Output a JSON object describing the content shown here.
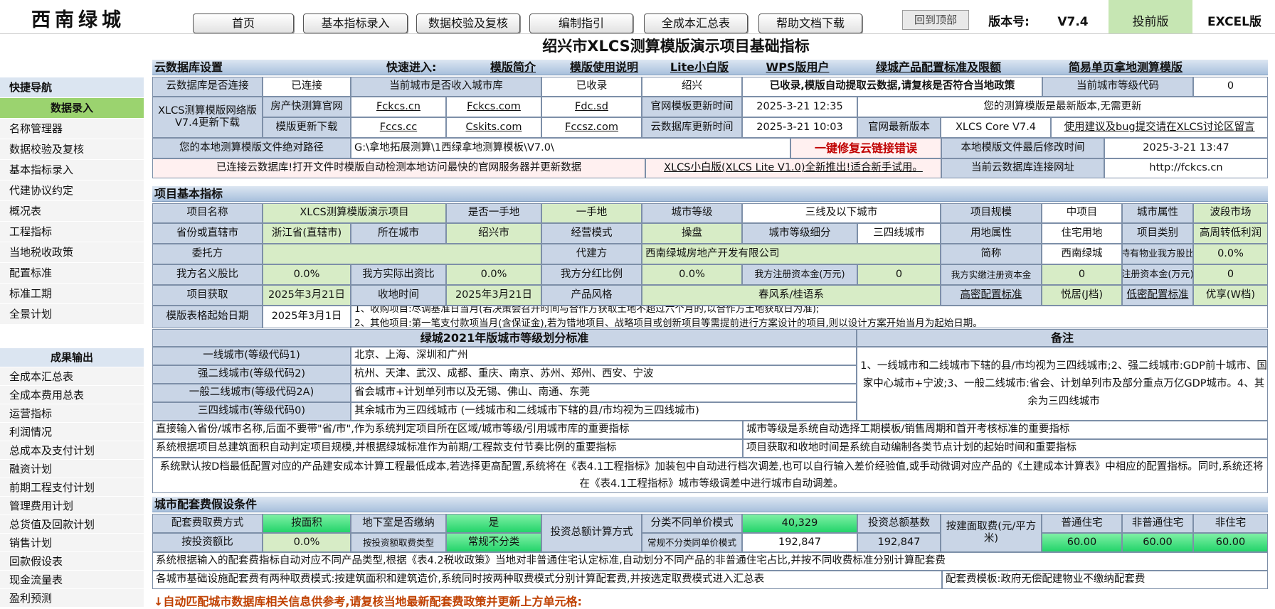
{
  "logo": "西南绿城",
  "nav": [
    "首页",
    "基本指标录入",
    "数据校验及复核",
    "编制指引",
    "全成本汇总表",
    "帮助文档下载"
  ],
  "back_top": "回到顶部",
  "version_label": "版本号:",
  "version_value": "V7.4",
  "edition": "投前版",
  "excel_edition": "EXCEL版",
  "page_title": "绍兴市XLCS测算模版演示项目基础指标",
  "sidebar": {
    "quick_title": "快捷导航",
    "quick": [
      "数据录入",
      "名称管理器",
      "数据校验及复核",
      "基本指标录入",
      "代建协议约定",
      "概况表",
      "工程指标",
      "当地税收政策",
      "配置标准",
      "标准工期",
      "全景计划"
    ],
    "output_title": "成果输出",
    "output": [
      "全成本汇总表",
      "全成本费用总表",
      "运营指标",
      "利润情况",
      "总成本及支付计划",
      "融资计划",
      "前期工程支付计划",
      "管理费用计划",
      "总货值及回款计划",
      "销售计划",
      "回款假设表",
      "现金流量表",
      "盈利预测"
    ]
  },
  "cloud": {
    "bar": "云数据库设置",
    "quick_label": "快速进入:",
    "links": [
      "模版简介",
      "模版使用说明",
      "Lite小白版",
      "WPS版用户",
      "绿城产品配置标准及限额",
      "简易单页拿地测算模版"
    ],
    "r1": [
      "云数据库是否连接",
      "已连接",
      "当前城市是否收入城市库",
      "已收录",
      "绍兴",
      "已收录,模版自动提取云数据,请复核是否符合当地政策",
      "当前城市等级代码",
      "0"
    ],
    "r23_label": "XLCS测算模版网络版V7.4更新下载",
    "r2": [
      "房产快测算官网",
      "Fckcs.cn",
      "Fckcs.com",
      "Fdc.sd",
      "官网模板更新时间",
      "2025-3-21  12:35",
      "您的测算模版是最新版本,无需更新"
    ],
    "r3": [
      "模版更新下载",
      "Fccs.cc",
      "Cskits.com",
      "Fccsz.com",
      "云数据库更新时间",
      "2025-3-21  10:03",
      "官网最新版本",
      "XLCS  Core V7.4",
      "使用建议及bug提交请在XLCS讨论区留言"
    ],
    "r4": [
      "您的本地测算模版文件绝对路径",
      "G:\\拿地拓展测算\\1西绿拿地测算模板\\V7.0\\",
      "一键修复云链接错误",
      "本地模版文件最后修改时间",
      "2025-3-21  13:47"
    ],
    "r5": [
      "已连接云数据库!打开文件时模版自动检测本地访问最快的官网服务器并更新数据",
      "XLCS小白版(XLCS Lite V1.0)全新推出!适合新手试用。",
      "当前云数据库连接网址",
      "http://fckcs.cn"
    ]
  },
  "project": {
    "bar": "项目基本指标",
    "r1": [
      "项目名称",
      "XLCS测算模版演示项目",
      "是否一手地",
      "一手地",
      "城市等级",
      "三线及以下城市",
      "项目规模",
      "中项目",
      "城市属性",
      "波段市场"
    ],
    "r2": [
      "省份或直辖市",
      "浙江省(直辖市)",
      "所在城市",
      "绍兴市",
      "经营模式",
      "操盘",
      "城市等级细分",
      "三四线城市",
      "用地属性",
      "住宅用地",
      "项目类别",
      "高周转低利润"
    ],
    "r3": [
      "委托方",
      "",
      "代建方",
      "西南绿城房地产开发有限公司",
      "简称",
      "西南绿城",
      "持有物业我方股比",
      "0.0%"
    ],
    "r4": [
      "我方名义股比",
      "0.0%",
      "我方实际出资比",
      "0.0%",
      "我方分红比例",
      "0.0%",
      "我方注册资本金(万元)",
      "0",
      "我方实缴注册资本金",
      "0",
      "注册资本金(万元)",
      "0"
    ],
    "r5": [
      "项目获取",
      "2025年3月21日",
      "收地时间",
      "2025年3月21日",
      "产品风格",
      "春风系/桂语系",
      "高密配置标准",
      "悦居(J档)",
      "低密配置标准",
      "优享(W档)"
    ],
    "r6": [
      "模版表格起始日期",
      "2025年3月1日",
      "1、收购项目:尽调基准日当月(若决策会召开时间与合作方获取土地不超过六个月的,以合作方土地获取日为准);",
      "2、其他项目:第一笔支付款项当月(含保证金),若为错地项目、战略项目或创新项目等需提前进行方案设计的项目,则以设计方案开始当月为起始日期。"
    ]
  },
  "citystd": {
    "title": "绿城2021年版城市等级划分标准",
    "note_title": "备注",
    "rows": [
      [
        "一线城市(等级代码1)",
        "北京、上海、深圳和广州"
      ],
      [
        "强二线城市(等级代码2)",
        "杭州、天津、武汉、成都、重庆、南京、苏州、郑州、西安、宁波"
      ],
      [
        "一般二线城市(等级代码2A)",
        "省会城市+计划单列市以及无锡、佛山、南通、东莞"
      ],
      [
        "三四线城市(等级代码0)",
        "其余城市为三四线城市 (一线城市和二线城市下辖的县/市均视为三四线城市)"
      ]
    ],
    "note": "1、一线城市和二线城市下辖的县/市均视为三四线城市;2、强二线城市:GDP前十城市、国家中心城市+宁波;3、一般二线城市:省会、计划单列市及部分重点万亿GDP城市。4、其余为三四线城市",
    "t1a": "直接输入省份/城市名称,后面不要带\"省/市\",作为系统判定项目所在区域/城市等级/引用城市库的重要指标",
    "t1b": "城市等级是系统自动选择工期模板/销售周期和首开考核标准的重要指标",
    "t2a": "系统根据项目总建筑面积自动判定项目规模,并根据绿城标准作为前期/工程款支付节奏比例的重要指标",
    "t2b": "项目获取和收地时间是系统自动编制各类节点计划的起始时间和重要指标",
    "t3": "系统默认按D档最低配置对应的产品建安成本计算工程最低成本,若选择更高配置,系统将在《表4.1工程指标》加装包中自动进行档次调差,也可以自行输入差价经验值,或手动微调对应产品的《土建成本计算表》中相应的配置指标。同时,系统还将在《表4.1工程指标》城市等级调差中进行城市自动调差。"
  },
  "fee": {
    "bar": "城市配套费假设条件",
    "r1": [
      "配套费取费方式",
      "按面积",
      "地下室是否缴纳",
      "是",
      "投资总额计算方式",
      "分类不同单价模式",
      "40,329",
      "投资总额基数",
      "192,847",
      "按建面取费(元/平方米)",
      "普通住宅",
      "非普通住宅",
      "非住宅"
    ],
    "r2": [
      "按投资额比",
      "0.0%",
      "按投资额取费类型",
      "常规不分类",
      "常规不分类同单价模式",
      "192,847",
      "60.00",
      "60.00",
      "60.00"
    ],
    "n1": "系统根据输入的配套费指标自动对应不同产品类型,根据《表4.2税收政策》当地对非普通住宅认定标准,自动划分不同产品的非普通住宅占比,并按不同收费标准分别计算配套费",
    "n2a": "各城市基础设施配套费有两种取费模式:按建筑面积和建筑造价,系统同时按两种取费模式分别计算配套费,并按选定取费模式进入汇总表",
    "n2b": "配套费模板:政府无偿配建物业不缴纳配套费",
    "n3": "↓自动匹配城市数据库相关信息供参考,请复核当地最新配套费政策并更新上方单元格:"
  }
}
